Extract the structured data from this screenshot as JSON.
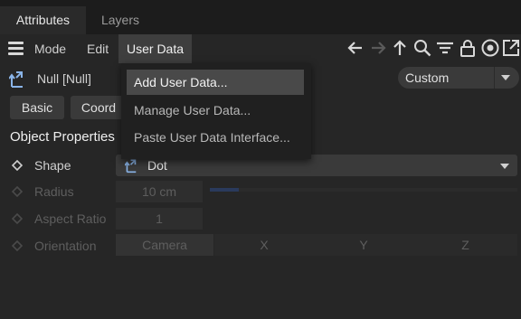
{
  "tabs": [
    {
      "label": "Attributes"
    },
    {
      "label": "Layers"
    }
  ],
  "menubar": {
    "items": [
      "Mode",
      "Edit",
      "User Data"
    ]
  },
  "object": {
    "name": "Null [Null]",
    "mode_value": "Custom"
  },
  "buttons": {
    "basic": "Basic",
    "coord": "Coord"
  },
  "section": {
    "title": "Object Properties"
  },
  "props": {
    "shape_label": "Shape",
    "shape_value": "Dot",
    "radius_label": "Radius",
    "radius_value": "10 cm",
    "aspect_label": "Aspect Ratio",
    "aspect_value": "1",
    "orientation_label": "Orientation",
    "orientation_options": [
      "Camera",
      "X",
      "Y",
      "Z"
    ]
  },
  "popup": {
    "items": [
      "Add User Data...",
      "Manage User Data...",
      "Paste User Data Interface..."
    ]
  },
  "colors": {
    "background": "#262626",
    "popup_bg": "#202020",
    "highlight": "#494949"
  },
  "icons": [
    "hamburger-icon",
    "back-arrow-icon",
    "forward-arrow-icon",
    "up-arrow-icon",
    "search-icon",
    "filter-icon",
    "lock-icon",
    "target-icon",
    "new-window-icon",
    "null-object-icon",
    "dropdown-arrow-icon",
    "keyframe-diamond-icon"
  ]
}
